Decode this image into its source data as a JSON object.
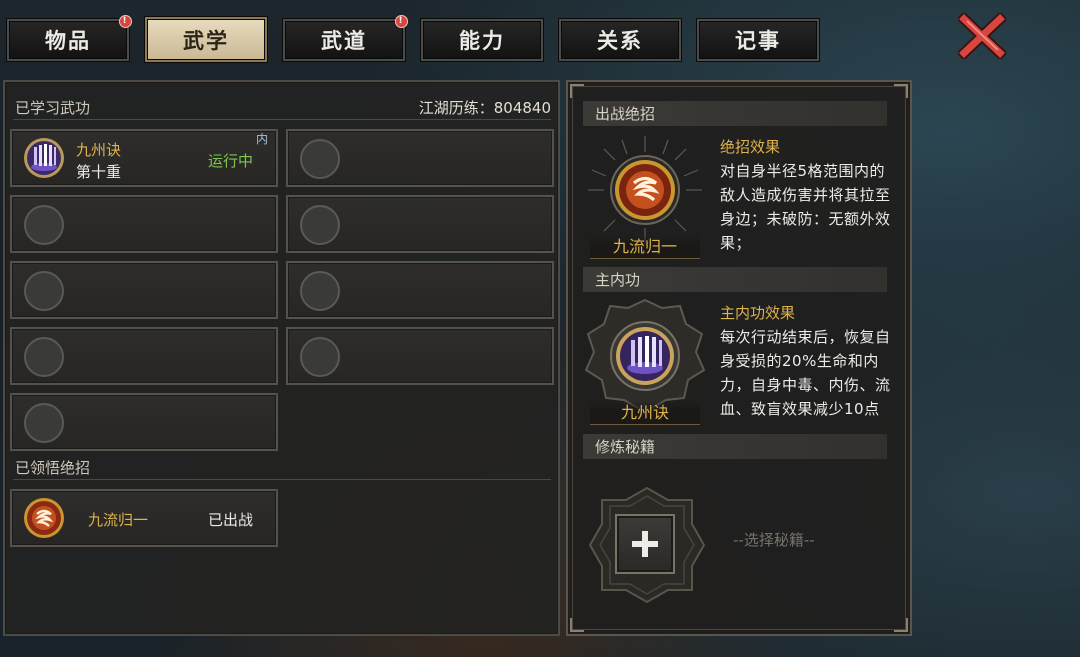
{
  "tabs": [
    {
      "label": "物品",
      "badge": "!"
    },
    {
      "label": "武学",
      "active": true
    },
    {
      "label": "武道",
      "badge": "!"
    },
    {
      "label": "能力"
    },
    {
      "label": "关系"
    },
    {
      "label": "记事"
    }
  ],
  "close_icon": "close-x-icon",
  "learned": {
    "title": "已学习武功",
    "exp_text": "江湖历练：804840",
    "skill": {
      "name": "九州诀",
      "level": "第十重",
      "status": "运行中",
      "tag": "内"
    }
  },
  "comprehended": {
    "title": "已领悟绝招",
    "skill": {
      "name": "九流归一",
      "status": "已出战"
    }
  },
  "battle": {
    "title": "出战绝招",
    "skill_name": "九流归一",
    "effect_title": "绝招效果",
    "effect_text": "对自身半径5格范围内的敌人造成伤害并将其拉至身边；未破防：无额外效果；"
  },
  "main_inner": {
    "title": "主内功",
    "skill_name": "九州诀",
    "effect_title": "主内功效果",
    "effect_text": "每次行动结束后，恢复自身受损的20%生命和内力，自身中毒、内伤、流血、致盲效果减少10点"
  },
  "book": {
    "title": "修炼秘籍",
    "placeholder": "--选择秘籍--"
  },
  "colors": {
    "accent": "#e0b24a",
    "running": "#7fc64e",
    "badge": "#d8443e",
    "close": "#d9463f"
  }
}
